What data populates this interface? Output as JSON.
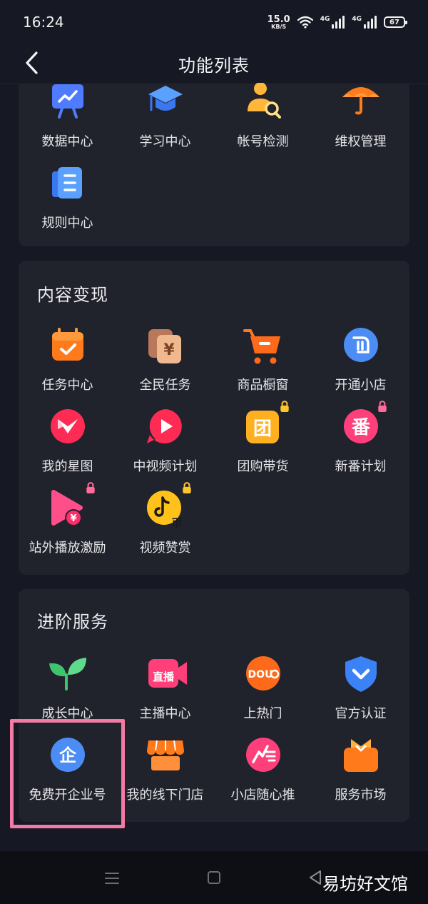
{
  "status": {
    "time": "16:24",
    "net_speed": "15.0",
    "net_unit": "KB/S",
    "sig1": "4G",
    "sig2": "4G",
    "battery": "67"
  },
  "header": {
    "title": "功能列表"
  },
  "section_top": {
    "items": [
      {
        "label": "数据中心",
        "icon": "chart-board-icon"
      },
      {
        "label": "学习中心",
        "icon": "graduation-cap-icon"
      },
      {
        "label": "帐号检测",
        "icon": "user-search-icon"
      },
      {
        "label": "维权管理",
        "icon": "umbrella-icon"
      },
      {
        "label": "规则中心",
        "icon": "rule-book-icon"
      }
    ]
  },
  "section_monetize": {
    "title": "内容变现",
    "items": [
      {
        "label": "任务中心",
        "icon": "calendar-check-icon"
      },
      {
        "label": "全民任务",
        "icon": "yen-cards-icon"
      },
      {
        "label": "商品橱窗",
        "icon": "shopping-cart-icon"
      },
      {
        "label": "开通小店",
        "icon": "shop-logo-icon"
      },
      {
        "label": "我的星图",
        "icon": "star-map-icon"
      },
      {
        "label": "中视频计划",
        "icon": "video-play-icon"
      },
      {
        "label": "团购带货",
        "icon": "group-buy-icon"
      },
      {
        "label": "新番计划",
        "icon": "anime-plan-icon"
      },
      {
        "label": "站外播放激励",
        "icon": "play-yen-icon"
      },
      {
        "label": "视频赞赏",
        "icon": "tiktok-coin-icon"
      }
    ]
  },
  "section_advanced": {
    "title": "进阶服务",
    "items": [
      {
        "label": "成长中心",
        "icon": "sprout-icon"
      },
      {
        "label": "主播中心",
        "icon": "live-camera-icon"
      },
      {
        "label": "上热门",
        "icon": "dou-plus-icon"
      },
      {
        "label": "官方认证",
        "icon": "shield-check-icon"
      },
      {
        "label": "免费开企业号",
        "icon": "enterprise-icon",
        "glyph": "企"
      },
      {
        "label": "我的线下门店",
        "icon": "storefront-icon"
      },
      {
        "label": "小店随心推",
        "icon": "speed-promote-icon"
      },
      {
        "label": "服务市场",
        "icon": "service-market-icon"
      }
    ]
  },
  "icon_glyphs": {
    "yen": "¥",
    "group": "团",
    "anime": "番",
    "live": "直播",
    "dou": "DOU",
    "coin": "币"
  },
  "watermark": "易坊好文馆",
  "colors": {
    "background": "#161823",
    "card": "#20222c",
    "highlight": "#f27aa3",
    "orange": "#ff8a1f",
    "pink": "#fe2c55",
    "blue": "#3b82f6"
  }
}
